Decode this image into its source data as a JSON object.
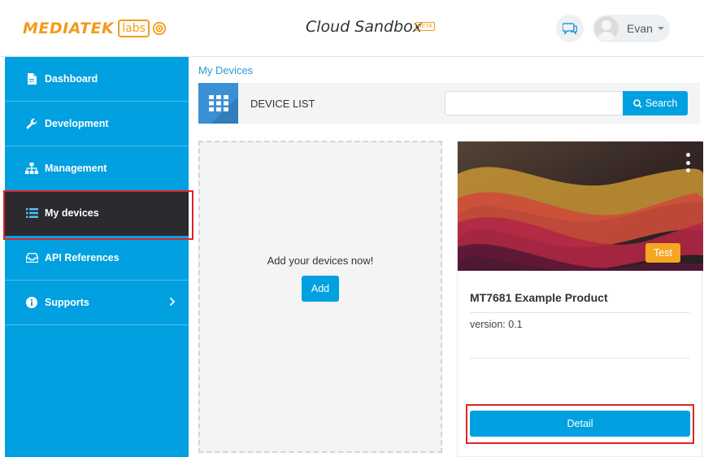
{
  "header": {
    "brand": "MEDIATEK",
    "brand_labs": "labs",
    "app_title": "Cloud Sandbox",
    "beta_badge": "BETA",
    "chat_icon": "chat-bubbles-icon",
    "user": {
      "name": "Evan",
      "avatar_icon": "user-avatar-icon"
    }
  },
  "sidebar": {
    "items": [
      {
        "label": "Dashboard",
        "icon": "document-icon"
      },
      {
        "label": "Development",
        "icon": "wrench-icon"
      },
      {
        "label": "Management",
        "icon": "sitemap-icon"
      },
      {
        "label": "My devices",
        "icon": "list-icon",
        "active": true
      },
      {
        "label": "API References",
        "icon": "inbox-icon"
      },
      {
        "label": "Supports",
        "icon": "info-icon",
        "has_submenu": true
      }
    ]
  },
  "main": {
    "breadcrumb": "My Devices",
    "toolbar": {
      "title": "DEVICE LIST",
      "search_value": "",
      "search_label": "Search"
    },
    "add_panel": {
      "message": "Add your devices now!",
      "add_label": "Add"
    },
    "device_card": {
      "badge": "Test",
      "name": "MT7681 Example Product",
      "version": "version: 0.1",
      "detail_label": "Detail"
    }
  },
  "colors": {
    "primary": "#01a0e0",
    "brand_orange": "#f29b1c",
    "sidebar_active": "#2b2a2f",
    "badge": "#f5a623",
    "highlight": "#e02424"
  }
}
